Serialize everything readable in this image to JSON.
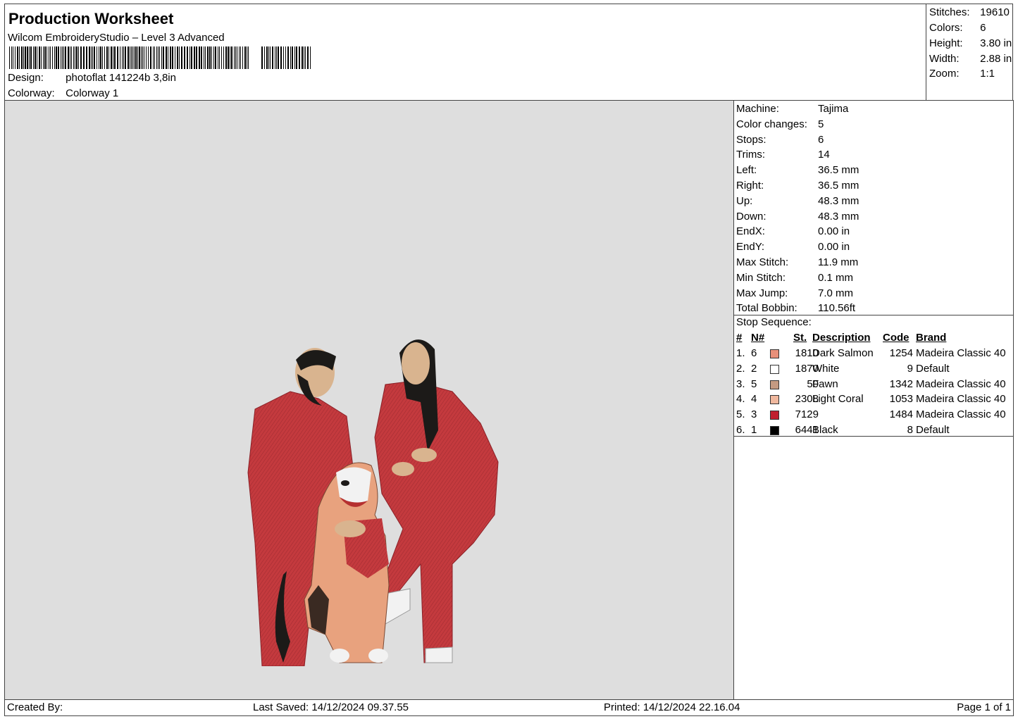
{
  "header": {
    "title": "Production Worksheet",
    "software": "Wilcom EmbroideryStudio – Level 3 Advanced",
    "design_label": "Design:",
    "design_value": "photoflat 141224b 3,8in",
    "colorway_label": "Colorway:",
    "colorway_value": "Colorway 1"
  },
  "summary": {
    "stitches_label": "Stitches:",
    "stitches": "19610",
    "colors_label": "Colors:",
    "colors": "6",
    "height_label": "Height:",
    "height": "3.80 in",
    "width_label": "Width:",
    "width": "2.88 in",
    "zoom_label": "Zoom:",
    "zoom": "1:1"
  },
  "machine_info": [
    {
      "label": "Machine:",
      "value": "Tajima"
    },
    {
      "label": "Color changes:",
      "value": "5"
    },
    {
      "label": "Stops:",
      "value": "6"
    },
    {
      "label": "Trims:",
      "value": "14"
    },
    {
      "label": "Left:",
      "value": "36.5 mm"
    },
    {
      "label": "Right:",
      "value": "36.5 mm"
    },
    {
      "label": "Up:",
      "value": "48.3 mm"
    },
    {
      "label": "Down:",
      "value": "48.3 mm"
    },
    {
      "label": "EndX:",
      "value": "0.00 in"
    },
    {
      "label": "EndY:",
      "value": "0.00 in"
    },
    {
      "label": "Max Stitch:",
      "value": "11.9 mm"
    },
    {
      "label": "Min Stitch:",
      "value": "0.1 mm"
    },
    {
      "label": "Max Jump:",
      "value": "7.0 mm"
    },
    {
      "label": "Total Bobbin:",
      "value": "110.56ft"
    }
  ],
  "stop_sequence": {
    "title": "Stop Sequence:",
    "headers": {
      "num": "#",
      "needle": "N#",
      "st": "St.",
      "description": "Description",
      "code": "Code",
      "brand": "Brand"
    },
    "rows": [
      {
        "num": "1.",
        "needle": "6",
        "st": "1810",
        "description": "Dark Salmon",
        "code": "1254",
        "brand": "Madeira Classic 40",
        "color": "#e8907a"
      },
      {
        "num": "2.",
        "needle": "2",
        "st": "1870",
        "description": "White",
        "code": "9",
        "brand": "Default",
        "color": "#ffffff"
      },
      {
        "num": "3.",
        "needle": "5",
        "st": "50",
        "description": "Fawn",
        "code": "1342",
        "brand": "Madeira Classic 40",
        "color": "#c49a82"
      },
      {
        "num": "4.",
        "needle": "4",
        "st": "2308",
        "description": "Light Coral",
        "code": "1053",
        "brand": "Madeira Classic 40",
        "color": "#f0b89e"
      },
      {
        "num": "5.",
        "needle": "3",
        "st": "7129",
        "description": "",
        "code": "1484",
        "brand": "Madeira Classic 40",
        "color": "#c0202e"
      },
      {
        "num": "6.",
        "needle": "1",
        "st": "6441",
        "description": "Black",
        "code": "8",
        "brand": "Default",
        "color": "#000000"
      }
    ]
  },
  "footer": {
    "created_by": "Created By:",
    "last_saved": "Last Saved: 14/12/2024 09.37.55",
    "printed": "Printed: 14/12/2024 22.16.04",
    "page": "Page 1 of 1"
  },
  "colors": {
    "preview_bg": "#dedede",
    "pajama_red": "#c43a3e",
    "skin": "#d9b48f",
    "hair": "#1c1a18"
  }
}
